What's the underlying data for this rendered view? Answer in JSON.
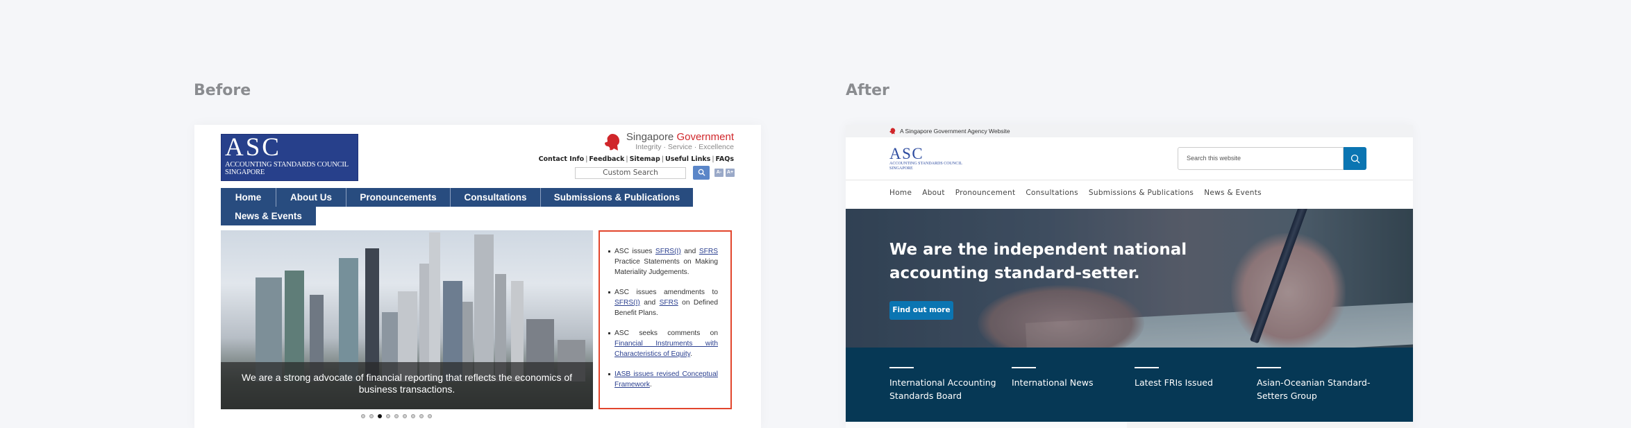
{
  "labels": {
    "before": "Before",
    "after": "After"
  },
  "before": {
    "logo": {
      "big": "ASC",
      "line1": "ACCOUNTING STANDARDS COUNCIL",
      "line2": "SINGAPORE"
    },
    "gov": {
      "name_grey": "Singapore ",
      "name_red": "Government",
      "tagline": "Integrity · Service · Excellence",
      "icon": "lion-head-icon"
    },
    "util_links": [
      "Contact Info",
      "Feedback",
      "Sitemap",
      "Useful Links",
      "FAQs"
    ],
    "search": {
      "placeholder": "Custom Search",
      "button_icon": "search-icon"
    },
    "font_size": {
      "decrease": "A-",
      "increase": "A+"
    },
    "nav": [
      "Home",
      "About Us",
      "Pronouncements",
      "Consultations",
      "Submissions & Publications",
      "News & Events"
    ],
    "hero": {
      "caption": "We are a strong advocate of financial reporting that reflects the economics of business transactions.",
      "slides": 9,
      "active_slide": 3
    },
    "news": [
      {
        "pre": "ASC issues ",
        "link1": "SFRS(I)",
        "mid": " and ",
        "link2": "SFRS",
        "post": " Practice Statements on Making Materiality Judgements."
      },
      {
        "pre": "ASC issues amendments to ",
        "link1": "SFRS(I)",
        "mid": " and ",
        "link2": "SFRS",
        "post": " on Defined Benefit Plans."
      },
      {
        "pre": "ASC seeks comments on ",
        "link1": "Financial Instruments with Characteristics of Equity",
        "mid": "",
        "link2": "",
        "post": "."
      },
      {
        "pre": "",
        "link1": "IASB issues revised Conceptual Framework",
        "mid": "",
        "link2": "",
        "post": "."
      }
    ]
  },
  "after": {
    "topbar": {
      "text": "A Singapore Government Agency Website",
      "icon": "lion-head-icon"
    },
    "logo": {
      "big": "ASC",
      "line1": "ACCOUNTING STANDARDS COUNCIL",
      "line2": "SINGAPORE"
    },
    "search": {
      "placeholder": "Search this website",
      "button_icon": "search-icon"
    },
    "nav": [
      "Home",
      "About",
      "Pronouncement",
      "Consultations",
      "Submissions & Publications",
      "News & Events"
    ],
    "hero": {
      "headline": "We are the independent national accounting standard-setter.",
      "cta": "Find out more"
    },
    "quick_links": [
      "International Accounting Standards Board",
      "International News",
      "Latest FRIs Issued",
      "Asian-Oceanian Standard-Setters Group"
    ]
  },
  "colors": {
    "before_navy": "#284c7f",
    "before_logo": "#27408b",
    "news_border": "#e2452c",
    "after_blue": "#0b75b2",
    "after_navy": "#063855",
    "gov_red": "#d0262a"
  }
}
